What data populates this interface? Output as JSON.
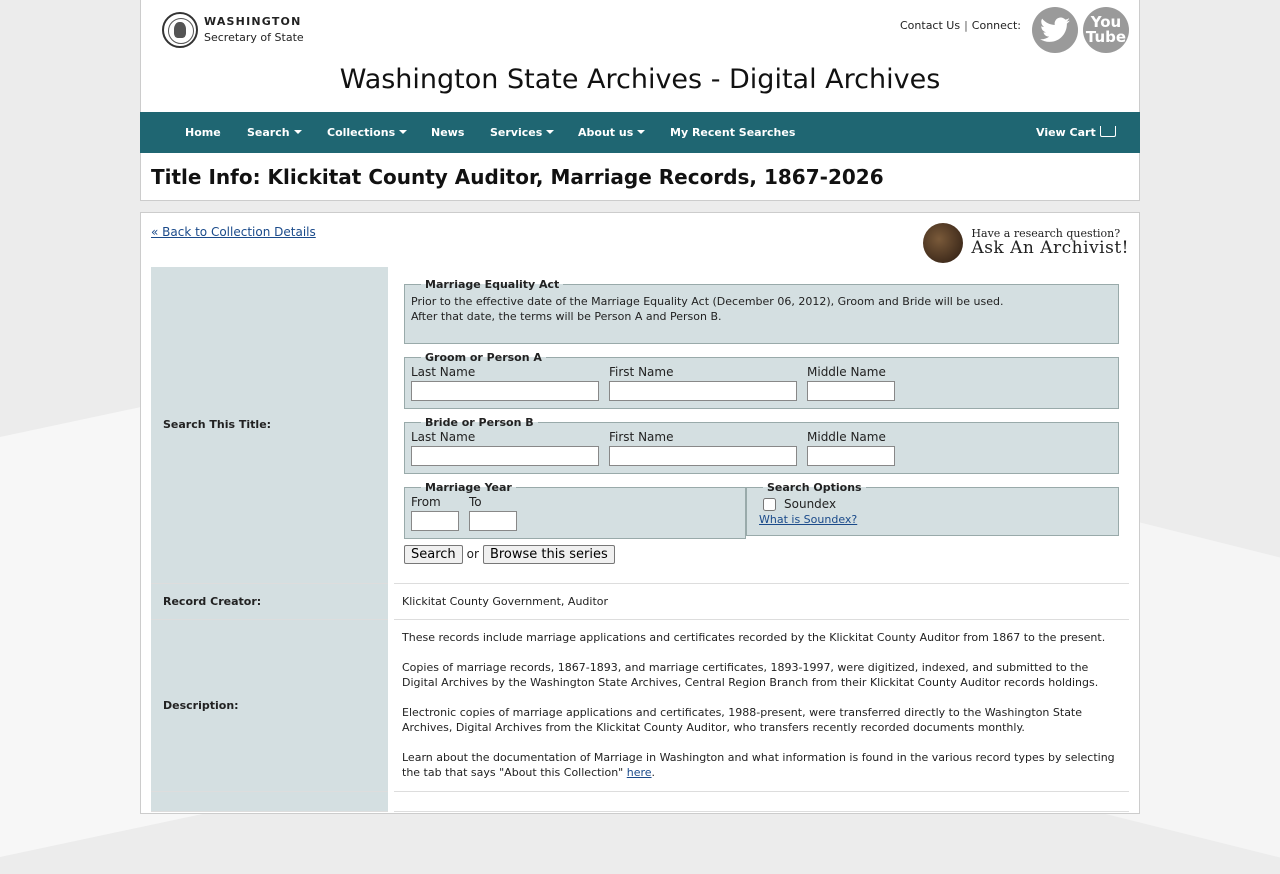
{
  "header": {
    "logo_line1": "WASHINGTON",
    "logo_line2": "Secretary of State",
    "contact_us": "Contact Us",
    "separator": "|",
    "connect": "Connect:",
    "youtube_l1": "You",
    "youtube_l2": "Tube",
    "site_title": "Washington State Archives - Digital Archives"
  },
  "nav": {
    "home": "Home",
    "search": "Search",
    "collections": "Collections",
    "news": "News",
    "services": "Services",
    "about": "About us",
    "recent": "My Recent Searches",
    "cart": "View Cart"
  },
  "page_title": "Title Info: Klickitat County Auditor, Marriage Records, 1867-2026",
  "back_link": "« Back to Collection Details",
  "ask": {
    "line1": "Have a research question?",
    "line2": "Ask An Archivist!"
  },
  "search_section": {
    "label": "Search This Title:",
    "equality": {
      "legend": "Marriage Equality Act",
      "text": "Prior to the effective date of the Marriage Equality Act (December 06, 2012), Groom and Bride will be used. After that date, the terms will be Person A and Person B."
    },
    "groom": {
      "legend": "Groom or Person A",
      "last": "Last Name",
      "first": "First Name",
      "middle": "Middle Name"
    },
    "bride": {
      "legend": "Bride or Person B",
      "last": "Last Name",
      "first": "First Name",
      "middle": "Middle Name"
    },
    "year": {
      "legend": "Marriage Year",
      "from": "From",
      "to": "To"
    },
    "options": {
      "legend": "Search Options",
      "soundex": "Soundex",
      "what_soundex": "What is Soundex?"
    },
    "search_button": "Search",
    "or": "or",
    "browse_button": "Browse this series"
  },
  "record_creator": {
    "label": "Record Creator:",
    "value": "Klickitat County Government, Auditor"
  },
  "description": {
    "label": "Description:",
    "p1": "These records include marriage applications and certificates recorded by the Klickitat County Auditor from 1867 to the present.",
    "p2": "Copies of marriage records, 1867-1893, and marriage certificates, 1893-1997, were digitized, indexed, and submitted to the Digital Archives by the Washington State Archives, Central Region Branch from their Klickitat County Auditor records holdings.",
    "p3": "Electronic copies of marriage applications and certificates, 1988-present, were transferred directly to the Washington State Archives, Digital Archives from the Klickitat County Auditor, who transfers recently recorded documents monthly.",
    "p4": "Learn about the documentation of Marriage in Washington and what information is found in the various record types by selecting the tab that says \"About this Collection\"",
    "p4_link": "here",
    "p4_end": "."
  }
}
